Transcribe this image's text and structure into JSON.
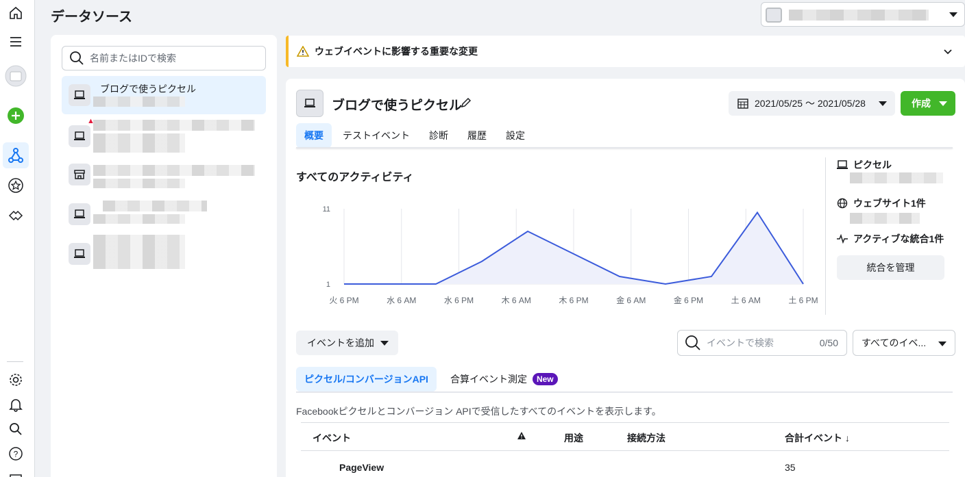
{
  "page": {
    "title": "データソース"
  },
  "source_search": {
    "placeholder": "名前またはIDで検索"
  },
  "sources": [
    {
      "name": "ブログで使うピクセル",
      "icon": "laptop-icon",
      "active": true
    }
  ],
  "banner": {
    "text": "ウェブイベントに影響する重要な変更"
  },
  "pixel": {
    "name": "ブログで使うピクセル",
    "date_range": "2021/05/25 〜 2021/05/28",
    "create_label": "作成"
  },
  "tabs": [
    "概要",
    "テストイベント",
    "診断",
    "履歴",
    "設定"
  ],
  "activity": {
    "title": "すべてのアクティビティ"
  },
  "chart_data": {
    "type": "area",
    "x": [
      "火 6 PM",
      "",
      "水 6 AM",
      "水 6 PM",
      "木 6 AM",
      "木 6 PM",
      "金 6 AM",
      "金 6 PM",
      "",
      "土 6 AM",
      "",
      "土 6 PM"
    ],
    "y": [
      1,
      1,
      1,
      4,
      8,
      5,
      2,
      1,
      2,
      10.5,
      1
    ],
    "tick_labels": [
      "火 6 PM",
      "水 6 AM",
      "水 6 PM",
      "木 6 AM",
      "木 6 PM",
      "金 6 AM",
      "金 6 PM",
      "土 6 AM",
      "土 6 PM"
    ],
    "yticks": [
      1,
      11
    ],
    "ylim": [
      1,
      11
    ],
    "color": "#3b5bdb",
    "fill": "#eef0fb"
  },
  "info": {
    "pixel_label": "ピクセル",
    "website_label": "ウェブサイト1件",
    "integration_label": "アクティブな統合1件",
    "manage_label": "統合を管理"
  },
  "events": {
    "add_label": "イベントを追加",
    "search_placeholder": "イベントで検索",
    "count": "0/50",
    "filter_label": "すべてのイベ...",
    "subtab_pixel": "ピクセル/コンバージョンAPI",
    "subtab_aggregated": "合算イベント測定",
    "new_badge": "New",
    "description": "Facebookピクセルとコンバージョン APIで受信したすべてのイベントを表示します。",
    "columns": [
      "イベント",
      "用途",
      "接続方法",
      "合計イベント ↓"
    ],
    "first_row": {
      "name": "PageView",
      "total": "35"
    }
  }
}
